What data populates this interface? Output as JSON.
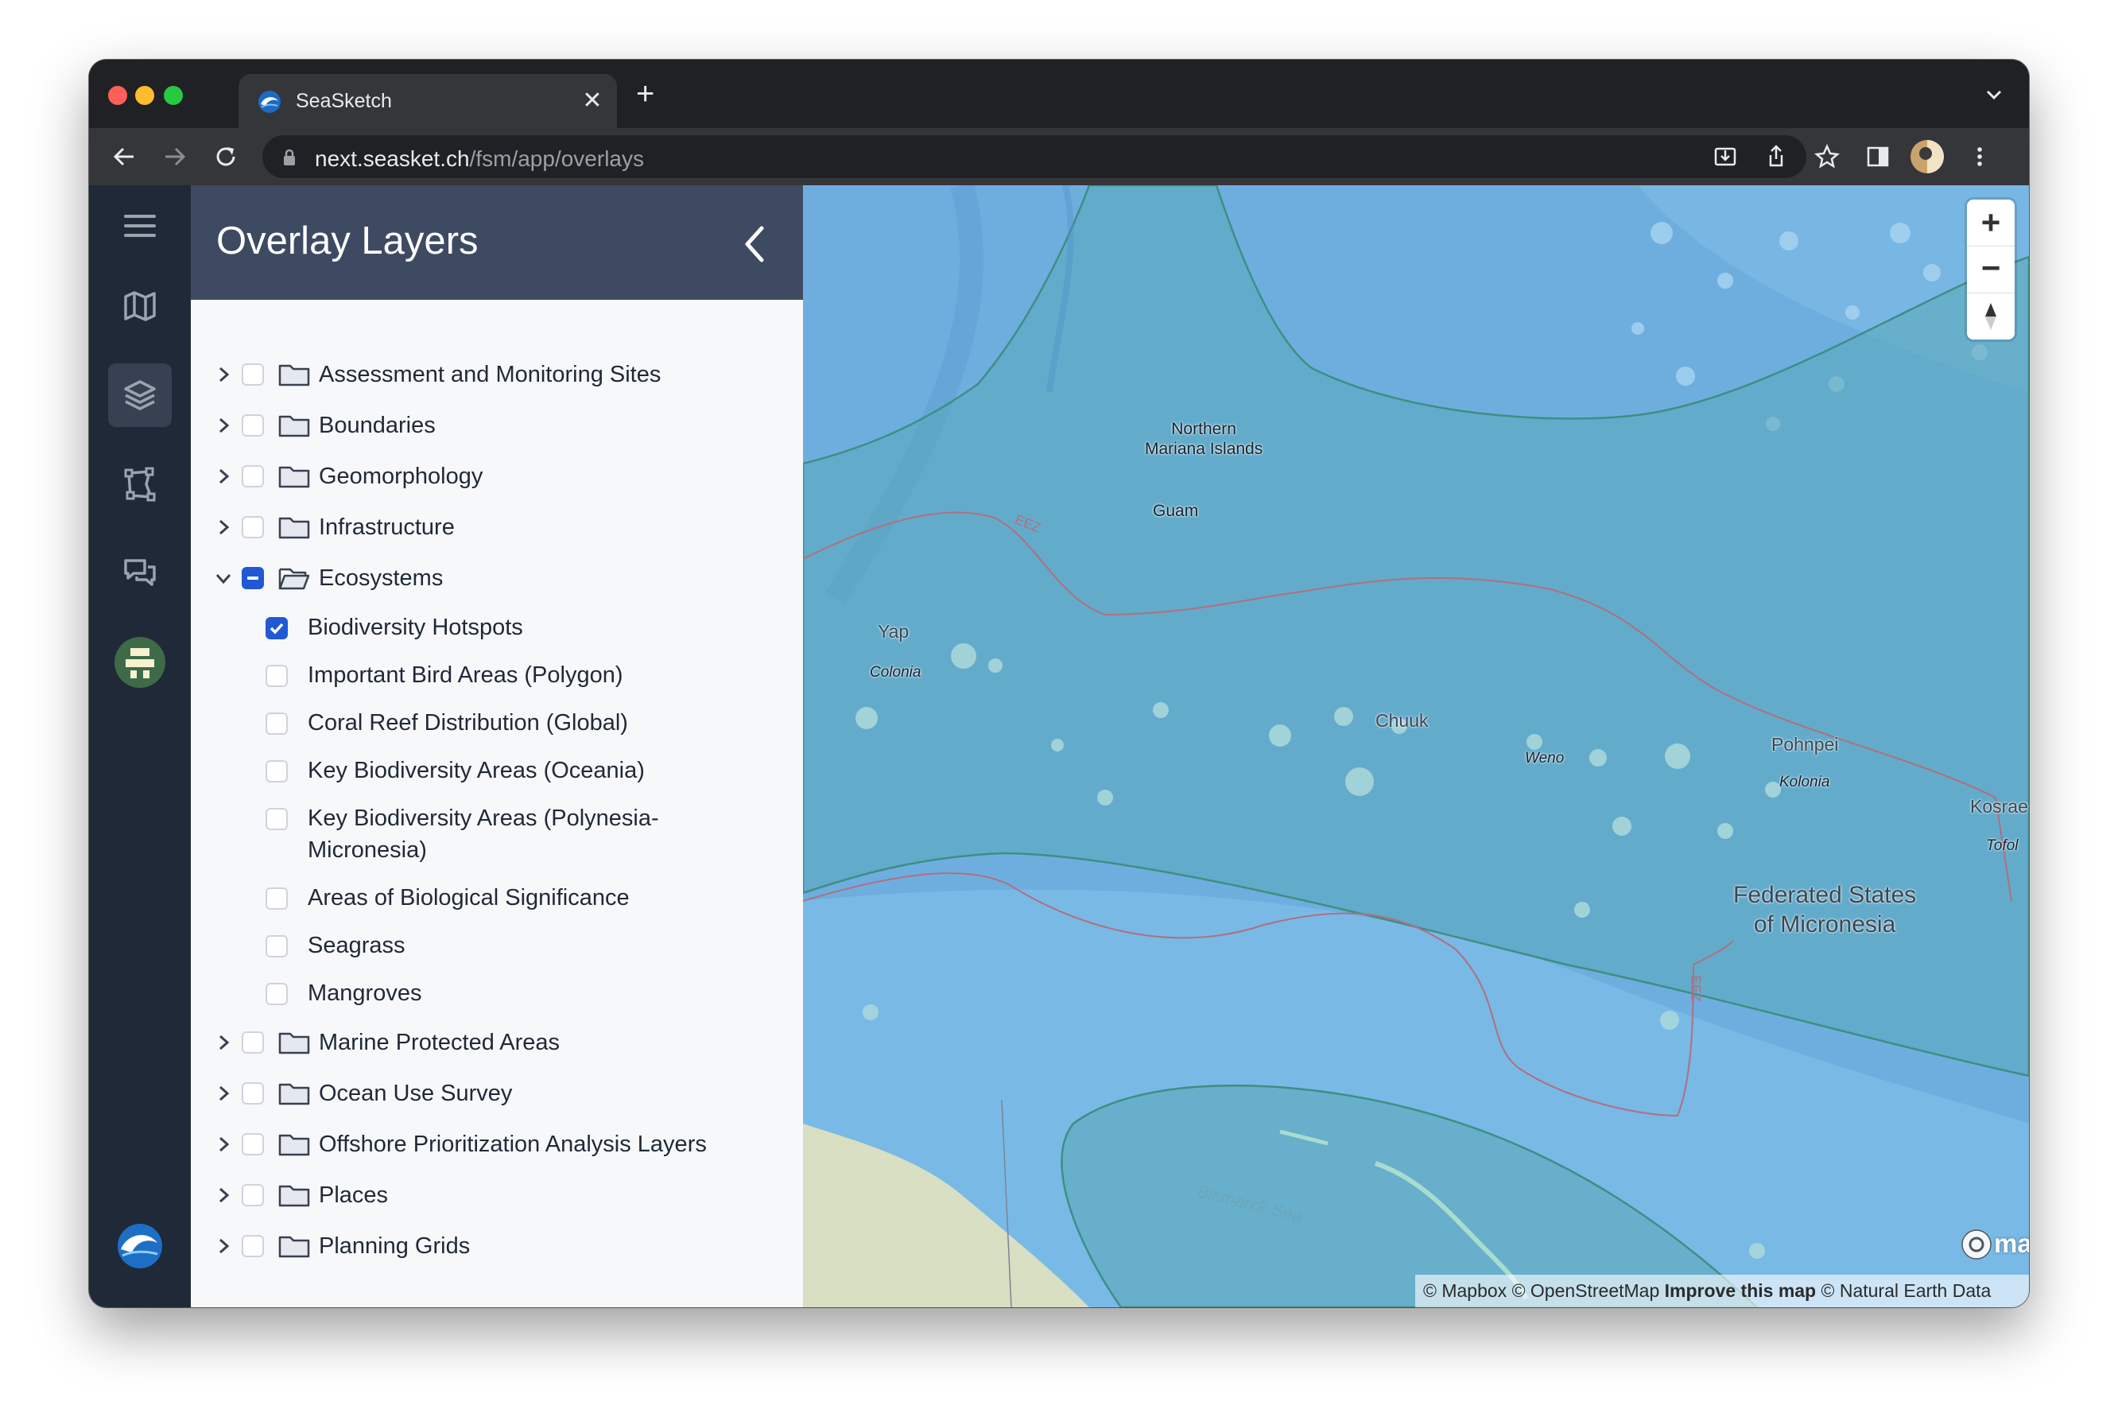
{
  "browser": {
    "tab_title": "SeaSketch",
    "new_tab": "+",
    "tab_close": "✕",
    "url_host": "next.seasket.ch",
    "url_path": "/fsm/app/overlays"
  },
  "sidebar": {
    "icons": [
      "menu-icon",
      "map-icon",
      "layers-icon",
      "sketch-icon",
      "discussion-icon",
      "avatar",
      "seasketch-logo"
    ],
    "active": "layers-icon"
  },
  "panel": {
    "title": "Overlay Layers",
    "items": [
      {
        "label": "Assessment and Monitoring Sites",
        "type": "folder",
        "expanded": false,
        "checked": false
      },
      {
        "label": "Boundaries",
        "type": "folder",
        "expanded": false,
        "checked": false
      },
      {
        "label": "Geomorphology",
        "type": "folder",
        "expanded": false,
        "checked": false
      },
      {
        "label": "Infrastructure",
        "type": "folder",
        "expanded": false,
        "checked": false
      },
      {
        "label": "Ecosystems",
        "type": "folder",
        "expanded": true,
        "checked": "partial",
        "children": [
          {
            "label": "Biodiversity Hotspots",
            "checked": true
          },
          {
            "label": "Important Bird Areas (Polygon)",
            "checked": false
          },
          {
            "label": "Coral Reef Distribution (Global)",
            "checked": false
          },
          {
            "label": "Key Biodiversity Areas (Oceania)",
            "checked": false
          },
          {
            "label_line1": "Key Biodiversity Areas (Polynesia-",
            "label_line2": "Micronesia)",
            "checked": false
          },
          {
            "label": "Areas of Biological Significance",
            "checked": false
          },
          {
            "label": "Seagrass",
            "checked": false
          },
          {
            "label": "Mangroves",
            "checked": false
          }
        ]
      },
      {
        "label": "Marine Protected Areas",
        "type": "folder",
        "expanded": false,
        "checked": false
      },
      {
        "label": "Ocean Use Survey",
        "type": "folder",
        "expanded": false,
        "checked": false
      },
      {
        "label": "Offshore Prioritization Analysis Layers",
        "type": "folder",
        "expanded": false,
        "checked": false
      },
      {
        "label": "Places",
        "type": "folder",
        "expanded": false,
        "checked": false
      },
      {
        "label": "Planning Grids",
        "type": "folder",
        "expanded": false,
        "checked": false
      }
    ]
  },
  "map": {
    "labels": {
      "northern_1": "Northern",
      "northern_2": "Mariana Islands",
      "guam": "Guam",
      "yap": "Yap",
      "colonia": "Colonia",
      "chuuk": "Chuuk",
      "weno": "Weno",
      "pohnpei": "Pohnpei",
      "kolonia": "Kolonia",
      "kosrae": "Kosrae",
      "tofol": "Tofol",
      "fsm_1": "Federated States",
      "fsm_2": "of Micronesia",
      "eez_1": "EEZ",
      "eez_2": "EEZ",
      "bismarck": "Bismarck Sea"
    },
    "zoom_in": "+",
    "zoom_out": "−",
    "attribution": {
      "mapbox": "© Mapbox",
      "osm": "© OpenStreetMap",
      "improve": "Improve this map",
      "ned": "© Natural Earth Data"
    },
    "logo_text": "mapbox",
    "colors": {
      "ocean": "#6eaedf",
      "hotspot_fill": "#5ba9b9",
      "land": "#d8dfc2"
    }
  }
}
